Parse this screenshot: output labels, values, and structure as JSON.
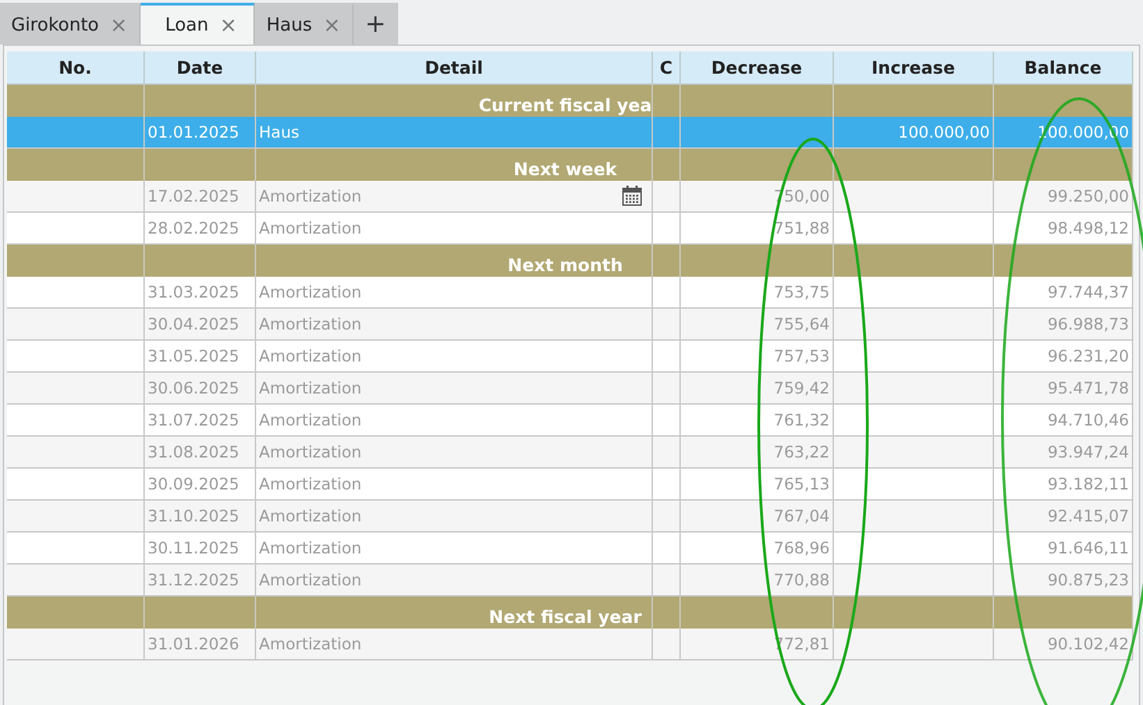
{
  "tabs": [
    {
      "label": "Girokonto",
      "selected": false,
      "close": "×"
    },
    {
      "label": "Loan",
      "selected": true,
      "close": "×"
    },
    {
      "label": "Haus",
      "selected": false,
      "close": "×"
    }
  ],
  "new_tab": "+",
  "table": {
    "columns": [
      "No.",
      "Date",
      "Detail",
      "C",
      "Decrease",
      "Increase",
      "Balance"
    ],
    "rows": [
      {
        "kind": "group",
        "label": "Current fiscal yea"
      },
      {
        "kind": "entry",
        "selected": true,
        "calendar_icon": false,
        "date": "01.01.2025",
        "detail": "Haus",
        "decrease": "",
        "increase": "100.000,00",
        "balance": "100.000,00"
      },
      {
        "kind": "group",
        "label": "Next week"
      },
      {
        "kind": "entry",
        "selected": false,
        "calendar_icon": true,
        "date": "17.02.2025",
        "detail": "Amortization",
        "decrease": "750,00",
        "increase": "",
        "balance": "99.250,00"
      },
      {
        "kind": "entry",
        "selected": false,
        "calendar_icon": false,
        "date": "28.02.2025",
        "detail": "Amortization",
        "decrease": "751,88",
        "increase": "",
        "balance": "98.498,12"
      },
      {
        "kind": "group",
        "label": "Next month"
      },
      {
        "kind": "entry",
        "selected": false,
        "calendar_icon": false,
        "date": "31.03.2025",
        "detail": "Amortization",
        "decrease": "753,75",
        "increase": "",
        "balance": "97.744,37"
      },
      {
        "kind": "entry",
        "selected": false,
        "calendar_icon": false,
        "date": "30.04.2025",
        "detail": "Amortization",
        "decrease": "755,64",
        "increase": "",
        "balance": "96.988,73"
      },
      {
        "kind": "entry",
        "selected": false,
        "calendar_icon": false,
        "date": "31.05.2025",
        "detail": "Amortization",
        "decrease": "757,53",
        "increase": "",
        "balance": "96.231,20"
      },
      {
        "kind": "entry",
        "selected": false,
        "calendar_icon": false,
        "date": "30.06.2025",
        "detail": "Amortization",
        "decrease": "759,42",
        "increase": "",
        "balance": "95.471,78"
      },
      {
        "kind": "entry",
        "selected": false,
        "calendar_icon": false,
        "date": "31.07.2025",
        "detail": "Amortization",
        "decrease": "761,32",
        "increase": "",
        "balance": "94.710,46"
      },
      {
        "kind": "entry",
        "selected": false,
        "calendar_icon": false,
        "date": "31.08.2025",
        "detail": "Amortization",
        "decrease": "763,22",
        "increase": "",
        "balance": "93.947,24"
      },
      {
        "kind": "entry",
        "selected": false,
        "calendar_icon": false,
        "date": "30.09.2025",
        "detail": "Amortization",
        "decrease": "765,13",
        "increase": "",
        "balance": "93.182,11"
      },
      {
        "kind": "entry",
        "selected": false,
        "calendar_icon": false,
        "date": "31.10.2025",
        "detail": "Amortization",
        "decrease": "767,04",
        "increase": "",
        "balance": "92.415,07"
      },
      {
        "kind": "entry",
        "selected": false,
        "calendar_icon": false,
        "date": "30.11.2025",
        "detail": "Amortization",
        "decrease": "768,96",
        "increase": "",
        "balance": "91.646,11"
      },
      {
        "kind": "entry",
        "selected": false,
        "calendar_icon": false,
        "date": "31.12.2025",
        "detail": "Amortization",
        "decrease": "770,88",
        "increase": "",
        "balance": "90.875,23"
      },
      {
        "kind": "group",
        "label": "Next fiscal year"
      },
      {
        "kind": "entry",
        "selected": false,
        "calendar_icon": false,
        "date": "31.01.2026",
        "detail": "Amortization",
        "decrease": "772,81",
        "increase": "",
        "balance": "90.102,42"
      }
    ]
  }
}
